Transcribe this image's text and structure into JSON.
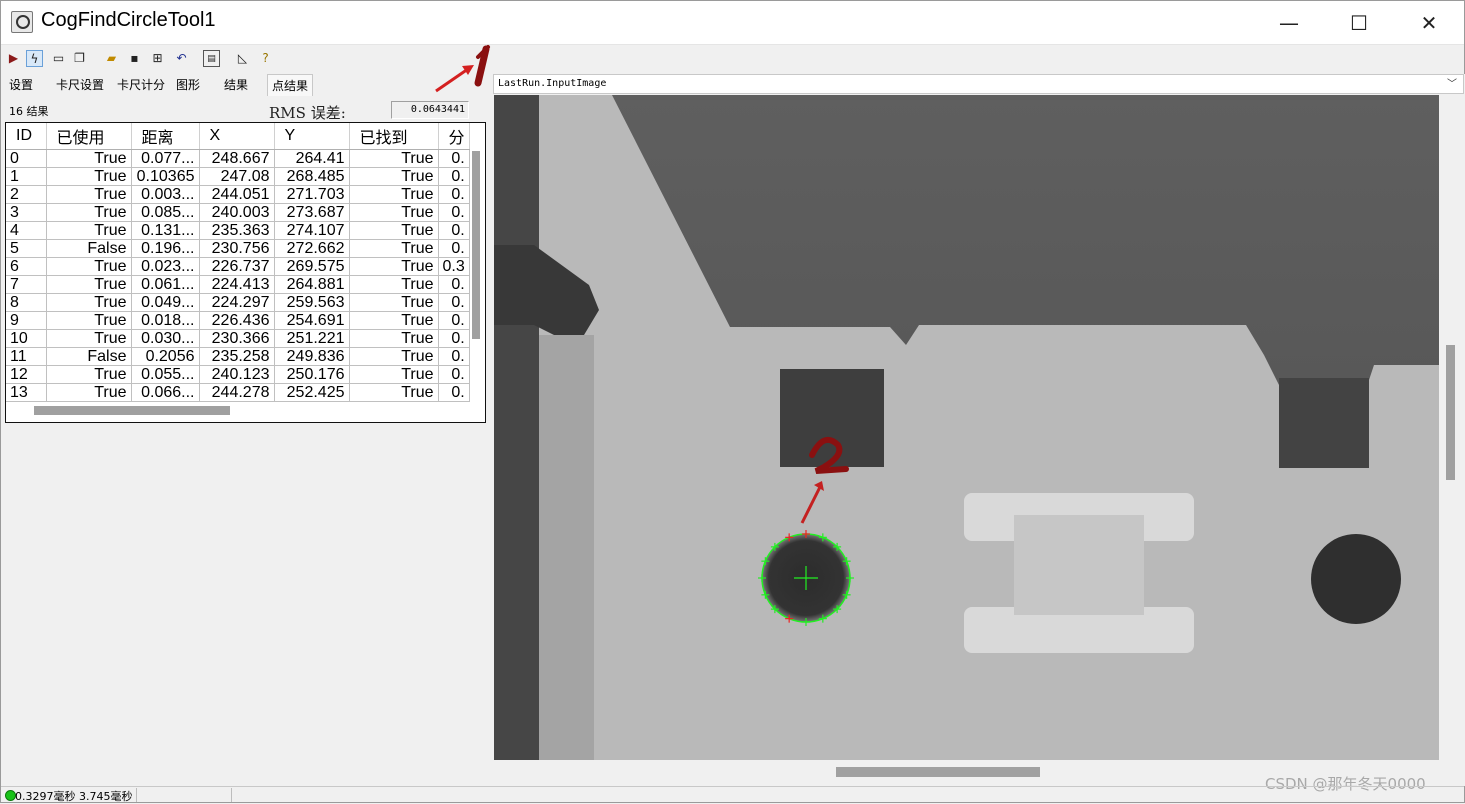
{
  "window": {
    "title": "CogFindCircleTool1",
    "minimize": "—",
    "maximize": "☐",
    "close": "✕"
  },
  "toolbar": {
    "icons": [
      "run-icon",
      "electric-icon",
      "display-icon",
      "copy-icon",
      "open-icon",
      "save-icon",
      "network-icon",
      "reset-icon",
      "calculator-icon",
      "measure-icon",
      "help-icon"
    ]
  },
  "tabs": [
    "设置",
    "卡尺设置",
    "卡尺计分",
    "图形",
    "结果",
    "点结果"
  ],
  "results": {
    "count_label": "16 结果",
    "rms_label": "RMS 误差:",
    "rms_value": "0.0643441"
  },
  "table": {
    "columns": [
      "ID",
      "已使用",
      "距离",
      "X",
      "Y",
      "已找到",
      "分"
    ],
    "rows": [
      [
        "0",
        "True",
        "0.077...",
        "248.667",
        "264.41",
        "True",
        "0."
      ],
      [
        "1",
        "True",
        "0.10365",
        "247.08",
        "268.485",
        "True",
        "0."
      ],
      [
        "2",
        "True",
        "0.003...",
        "244.051",
        "271.703",
        "True",
        "0."
      ],
      [
        "3",
        "True",
        "0.085...",
        "240.003",
        "273.687",
        "True",
        "0."
      ],
      [
        "4",
        "True",
        "0.131...",
        "235.363",
        "274.107",
        "True",
        "0."
      ],
      [
        "5",
        "False",
        "0.196...",
        "230.756",
        "272.662",
        "True",
        "0."
      ],
      [
        "6",
        "True",
        "0.023...",
        "226.737",
        "269.575",
        "True",
        "0.3"
      ],
      [
        "7",
        "True",
        "0.061...",
        "224.413",
        "264.881",
        "True",
        "0."
      ],
      [
        "8",
        "True",
        "0.049...",
        "224.297",
        "259.563",
        "True",
        "0."
      ],
      [
        "9",
        "True",
        "0.018...",
        "226.436",
        "254.691",
        "True",
        "0."
      ],
      [
        "10",
        "True",
        "0.030...",
        "230.366",
        "251.221",
        "True",
        "0."
      ],
      [
        "11",
        "False",
        "0.2056",
        "235.258",
        "249.836",
        "True",
        "0."
      ],
      [
        "12",
        "True",
        "0.055...",
        "240.123",
        "250.176",
        "True",
        "0."
      ],
      [
        "13",
        "True",
        "0.066...",
        "244.278",
        "252.425",
        "True",
        "0."
      ]
    ]
  },
  "image": {
    "selector": "LastRun.InputImage",
    "circle_color": "#22ee22",
    "annotation_color": "#8a1010"
  },
  "status": {
    "text": "0.3297毫秒 3.745毫秒"
  },
  "watermark": "CSDN @那年冬天0000"
}
